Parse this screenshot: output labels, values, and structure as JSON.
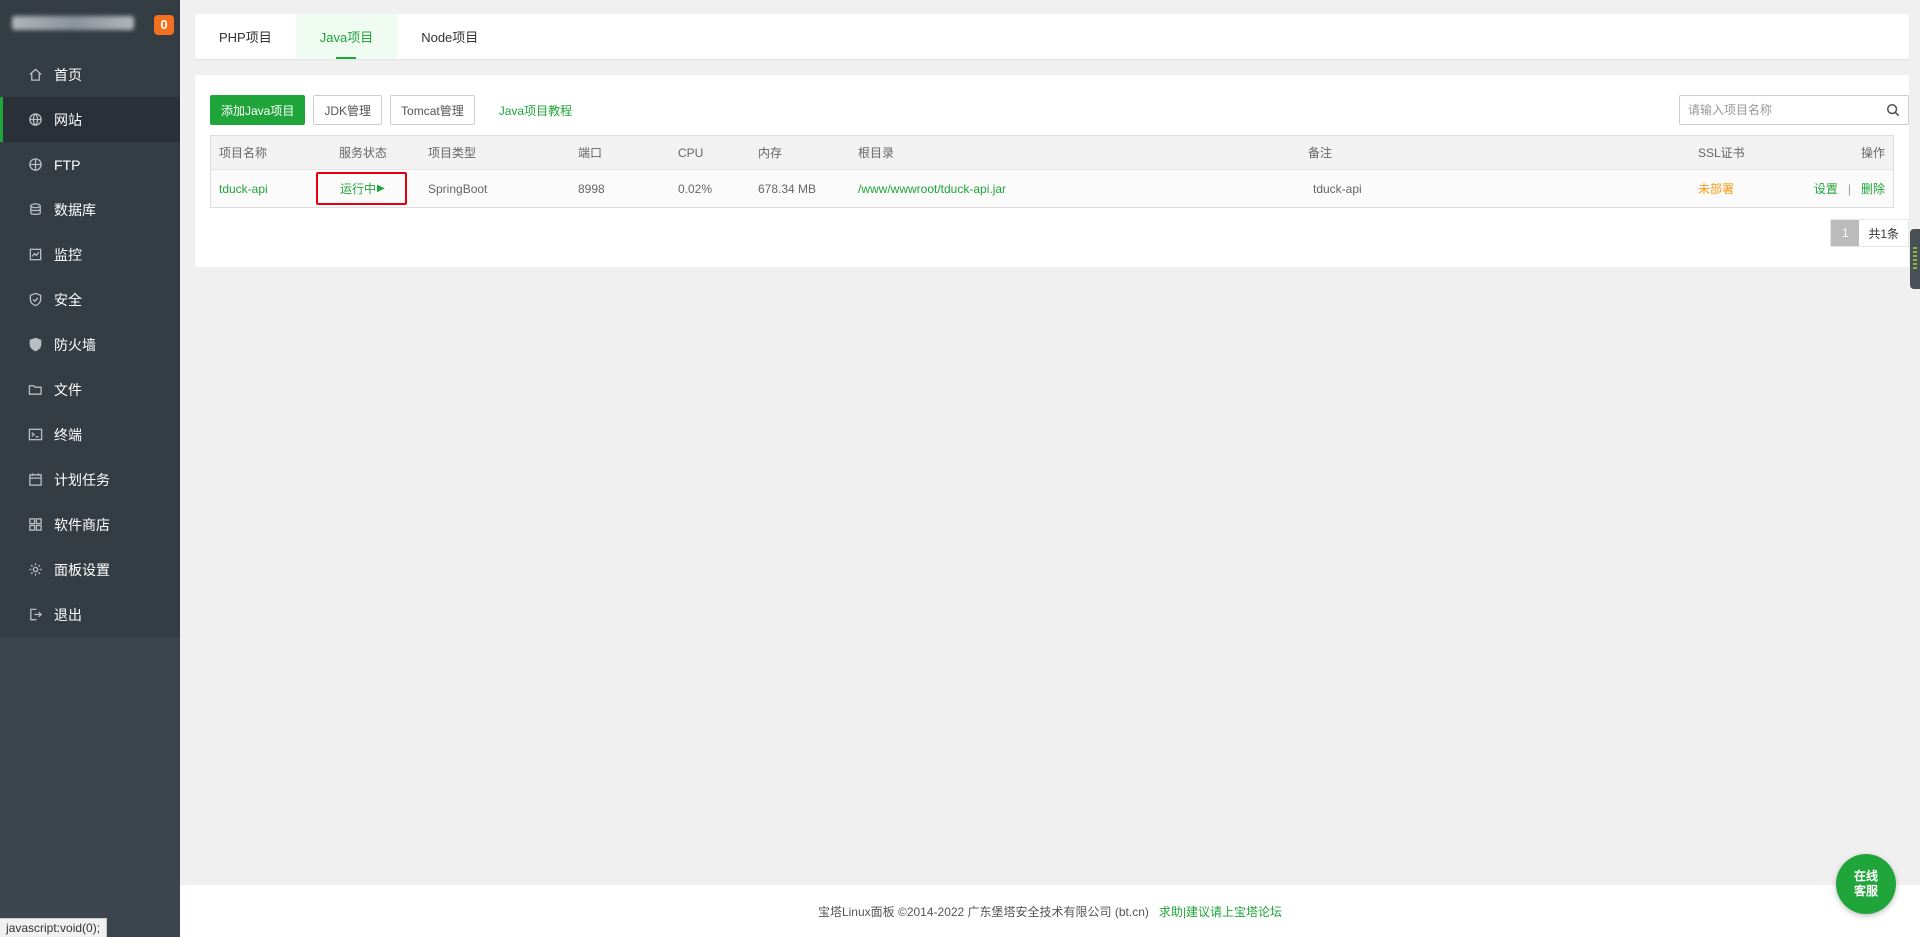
{
  "sidebar": {
    "badge": "0",
    "items": [
      {
        "label": "首页",
        "icon": "home-icon"
      },
      {
        "label": "网站",
        "icon": "globe-icon"
      },
      {
        "label": "FTP",
        "icon": "ftp-icon"
      },
      {
        "label": "数据库",
        "icon": "database-icon"
      },
      {
        "label": "监控",
        "icon": "monitor-icon"
      },
      {
        "label": "安全",
        "icon": "shield-icon"
      },
      {
        "label": "防火墙",
        "icon": "firewall-icon"
      },
      {
        "label": "文件",
        "icon": "folder-icon"
      },
      {
        "label": "终端",
        "icon": "terminal-icon"
      },
      {
        "label": "计划任务",
        "icon": "calendar-icon"
      },
      {
        "label": "软件商店",
        "icon": "apps-icon"
      },
      {
        "label": "面板设置",
        "icon": "gear-icon"
      },
      {
        "label": "退出",
        "icon": "logout-icon"
      }
    ],
    "active_index": 1
  },
  "status_tip": "javascript:void(0);",
  "tabs": [
    {
      "label": "PHP项目"
    },
    {
      "label": "Java项目"
    },
    {
      "label": "Node项目"
    }
  ],
  "active_tab": 1,
  "toolbar": {
    "add_label": "添加Java项目",
    "jdk_label": "JDK管理",
    "tomcat_label": "Tomcat管理",
    "tutorial_label": "Java项目教程"
  },
  "search": {
    "placeholder": "请输入项目名称",
    "value": ""
  },
  "table": {
    "headers": {
      "name": "项目名称",
      "status": "服务状态",
      "type": "项目类型",
      "port": "端口",
      "cpu": "CPU",
      "memory": "内存",
      "root": "根目录",
      "remark": "备注",
      "ssl": "SSL证书",
      "ops": "操作"
    },
    "rows": [
      {
        "name": "tduck-api",
        "status": "运行中",
        "status_icon": "▶",
        "type": "SpringBoot",
        "port": "8998",
        "cpu": "0.02%",
        "memory": "678.34 MB",
        "root": "/www/wwwroot/tduck-api.jar",
        "remark": "tduck-api",
        "ssl": "未部署",
        "op_settings": "设置",
        "op_separator": "|",
        "op_delete": "删除"
      }
    ]
  },
  "pager": {
    "current": "1",
    "total": "共1条"
  },
  "footer": {
    "copyright": "宝塔Linux面板 ©2014-2022 广东堡塔安全技术有限公司 (bt.cn)",
    "help": "求助|建议请上宝塔论坛"
  },
  "chat": {
    "line1": "在线",
    "line2": "客服"
  },
  "colors": {
    "accent": "#20a53a",
    "sidebar": "#3c444d",
    "warning": "#f39c12",
    "highlight": "#e60012",
    "badge": "#f5701f"
  }
}
